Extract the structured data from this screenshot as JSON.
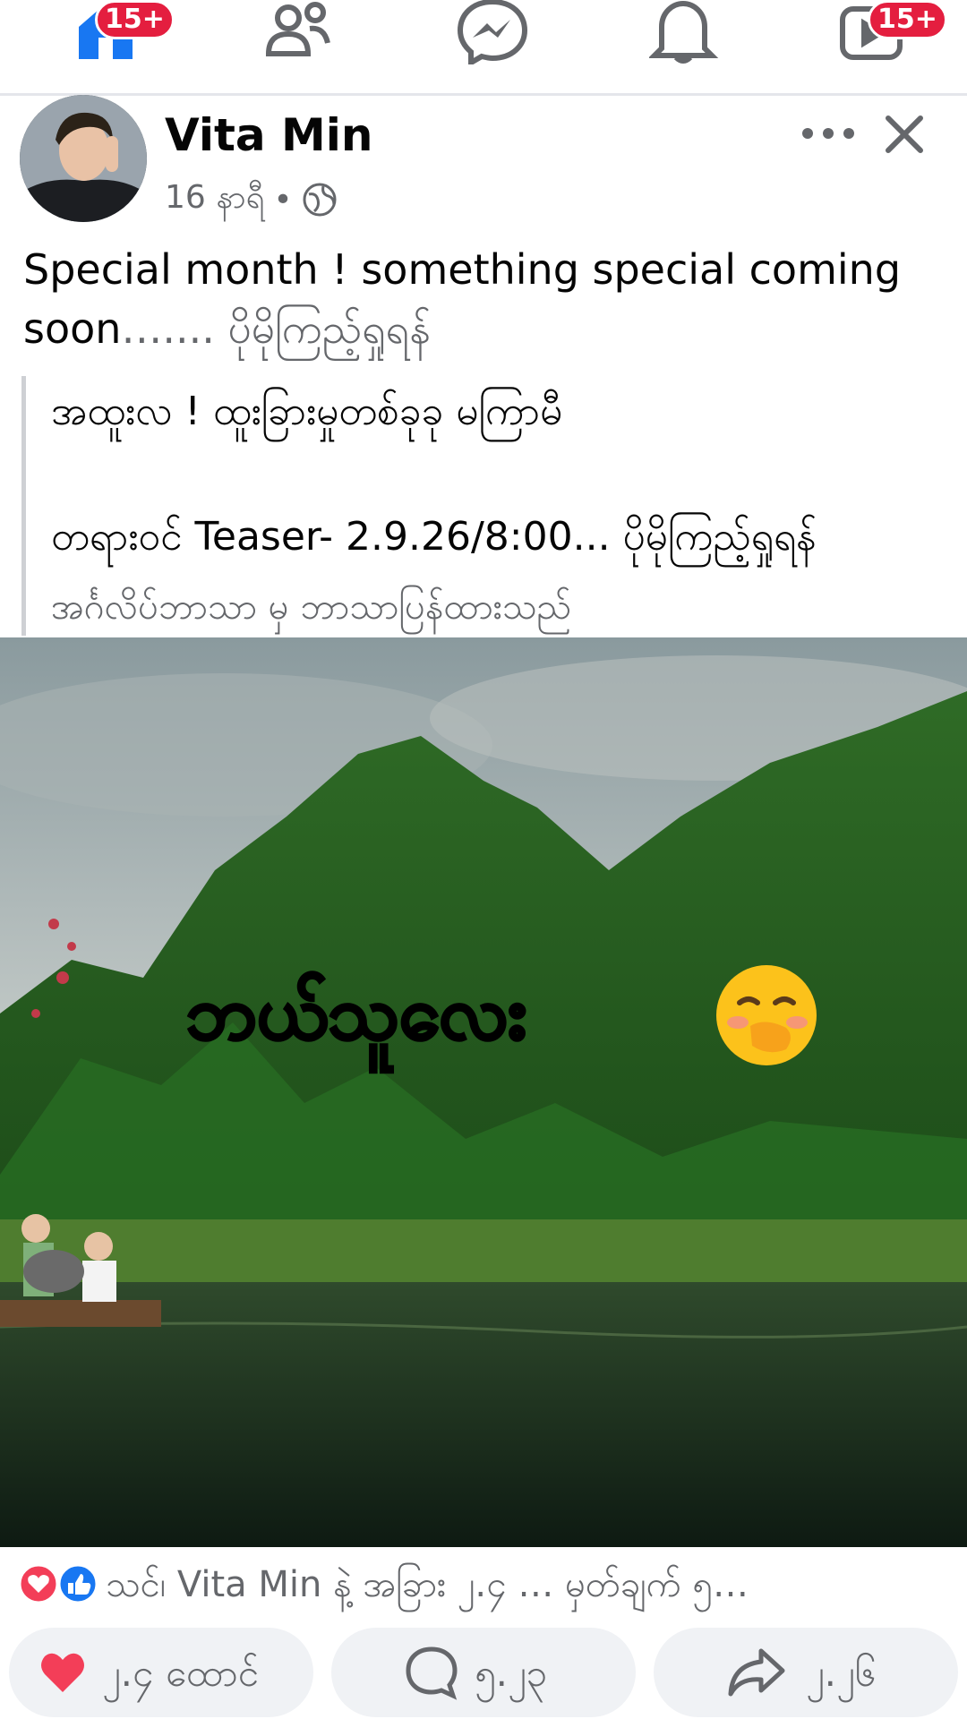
{
  "nav": {
    "home_badge": "15+",
    "video_badge": "15+"
  },
  "post": {
    "author": "Vita Min",
    "time": "16 နာရီ",
    "separator": "•",
    "text_main": "Special month ! something special coming soon",
    "text_ellipsis": "…....",
    "text_see_translation": "ပိုမိုကြည့်ရှုရန်",
    "translated_line1": "အထူးလ ! ထူးခြားမှုတစ်ခုခု မကြာမီ",
    "translated_line2": "တရားဝင် Teaser- 2.9.26/8:00... ပိုမိုကြည့်ရှုရန်",
    "translated_note": "အင်္ဂလိပ်ဘာသာ မှ ဘာသာပြန်ထားသည်",
    "image_caption": "ဘယ်သူလေး"
  },
  "footer": {
    "reaction_summary": "သင်၊ Vita Min နဲ့ အခြား ၂.၄ … မှတ်ချက် ၅…",
    "like_count": "၂.၄ ထောင်",
    "comment_count": "၅.၂၃",
    "share_count": "၂.၂၆"
  },
  "colors": {
    "accent": "#1877f2",
    "badge": "#e41e3f",
    "love": "#f33e58"
  }
}
